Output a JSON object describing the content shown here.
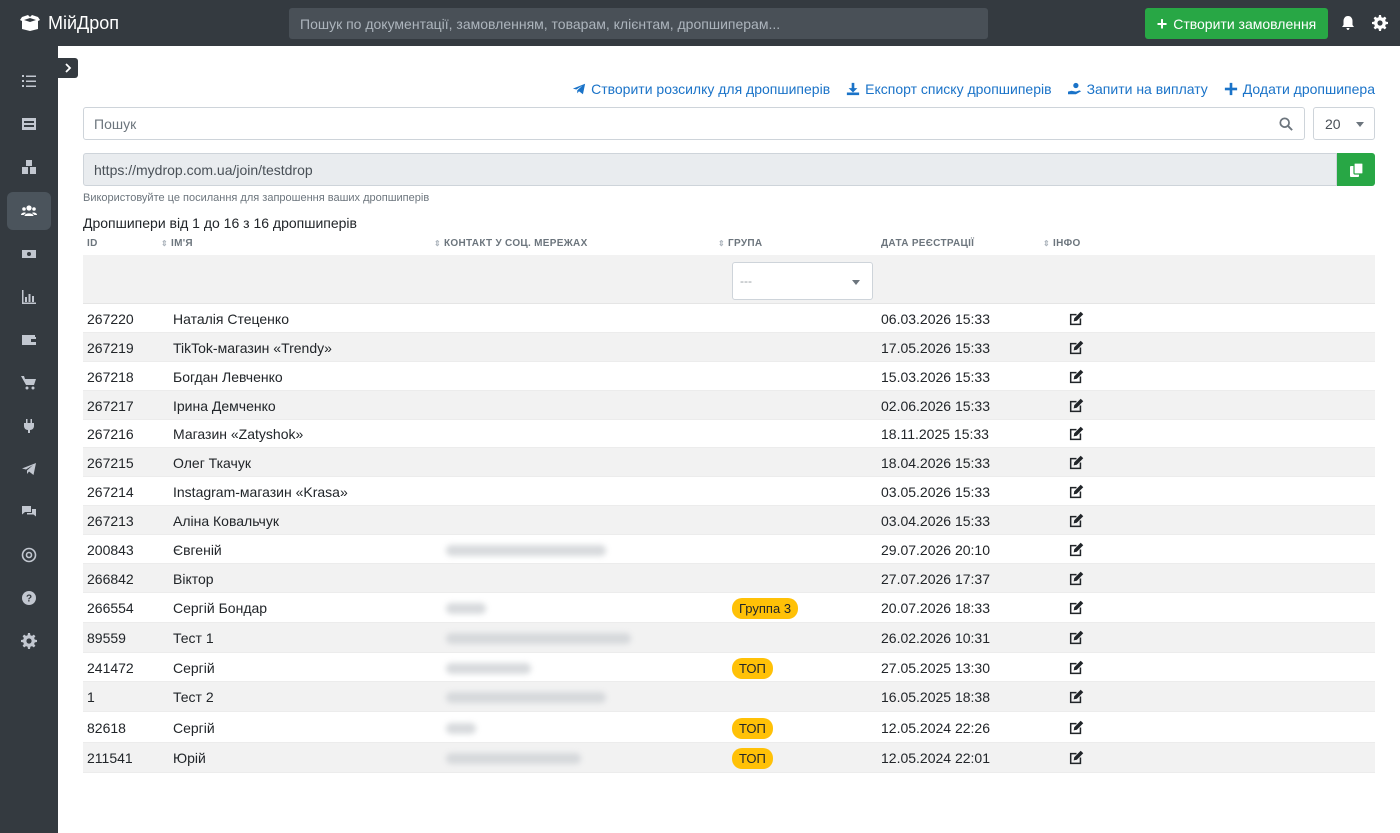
{
  "app": {
    "title": "МійДроп"
  },
  "header": {
    "search_placeholder": "Пошук по документації, замовленням, товарам, клієнтам, дропшиперам...",
    "create_order_label": "Створити замовлення"
  },
  "sidebar": {
    "items": [
      {
        "icon": "list-icon"
      },
      {
        "icon": "table-icon"
      },
      {
        "icon": "boxes-icon"
      },
      {
        "icon": "users-icon",
        "active": true
      },
      {
        "icon": "money-icon"
      },
      {
        "icon": "chart-icon"
      },
      {
        "icon": "wallet-icon"
      },
      {
        "icon": "cart-icon"
      },
      {
        "icon": "plug-icon"
      },
      {
        "icon": "telegram-icon"
      },
      {
        "icon": "comments-icon"
      },
      {
        "icon": "ai-icon"
      },
      {
        "icon": "help-icon"
      },
      {
        "icon": "settings-icon"
      }
    ]
  },
  "actions": {
    "mailing": "Створити розсилку для дропшиперів",
    "export": "Експорт списку дропшиперів",
    "payouts": "Запити на виплату",
    "add": "Додати дропшипера"
  },
  "search": {
    "placeholder": "Пошук",
    "per_page": "20"
  },
  "invite": {
    "url": "https://mydrop.com.ua/join/testdrop",
    "hint": "Використовуйте це посилання для запрошення ваших дропшиперів"
  },
  "summary": "Дропшипери від 1 до 16 з 16 дропшиперів",
  "table": {
    "columns": [
      "ID",
      "ІМ'Я",
      "КОНТАКТ У СОЦ. МЕРЕЖАХ",
      "ГРУПА",
      "ДАТА РЕЄСТРАЦІЇ",
      "ІНФО"
    ],
    "group_filter_placeholder": "---",
    "rows": [
      {
        "id": "267220",
        "name": "Наталія Стеценко",
        "contact": "",
        "group": "",
        "date": "06.03.2026 15:33"
      },
      {
        "id": "267219",
        "name": "TikTok-магазин «Trendy»",
        "contact": "",
        "group": "",
        "date": "17.05.2026 15:33"
      },
      {
        "id": "267218",
        "name": "Богдан Левченко",
        "contact": "",
        "group": "",
        "date": "15.03.2026 15:33"
      },
      {
        "id": "267217",
        "name": "Ірина Демченко",
        "contact": "",
        "group": "",
        "date": "02.06.2026 15:33"
      },
      {
        "id": "267216",
        "name": "Магазин «Zatyshok»",
        "contact": "",
        "group": "",
        "date": "18.11.2025 15:33"
      },
      {
        "id": "267215",
        "name": "Олег Ткачук",
        "contact": "",
        "group": "",
        "date": "18.04.2026 15:33"
      },
      {
        "id": "267214",
        "name": "Instagram-магазин «Krasa»",
        "contact": "",
        "group": "",
        "date": "03.05.2026 15:33"
      },
      {
        "id": "267213",
        "name": "Аліна Ковальчук",
        "contact": "",
        "group": "",
        "date": "03.04.2026 15:33"
      },
      {
        "id": "200843",
        "name": "Євгеній",
        "contact": "blurred",
        "group": "",
        "date": "29.07.2026 20:10"
      },
      {
        "id": "266842",
        "name": "Віктор",
        "contact": "",
        "group": "",
        "date": "27.07.2026 17:37"
      },
      {
        "id": "266554",
        "name": "Сергій Бондар",
        "contact": "blurred",
        "group": "Группа 3",
        "date": "20.07.2026 18:33"
      },
      {
        "id": "89559",
        "name": "Тест 1",
        "contact": "blurred",
        "group": "",
        "date": "26.02.2026 10:31"
      },
      {
        "id": "241472",
        "name": "Сергій",
        "contact": "blurred",
        "group": "ТОП",
        "date": "27.05.2025 13:30"
      },
      {
        "id": "1",
        "name": "Тест 2",
        "contact": "blurred",
        "group": "",
        "date": "16.05.2025 18:38"
      },
      {
        "id": "82618",
        "name": "Сергій",
        "contact": "blurred",
        "group": "ТОП",
        "date": "12.05.2024 22:26"
      },
      {
        "id": "211541",
        "name": "Юрій",
        "contact": "blurred",
        "group": "ТОП",
        "date": "12.05.2024 22:01"
      }
    ]
  },
  "colors": {
    "sidebar": "#343a40",
    "accent_green": "#28a745",
    "link_blue": "#1a73c8",
    "badge_yellow": "#ffc107"
  }
}
